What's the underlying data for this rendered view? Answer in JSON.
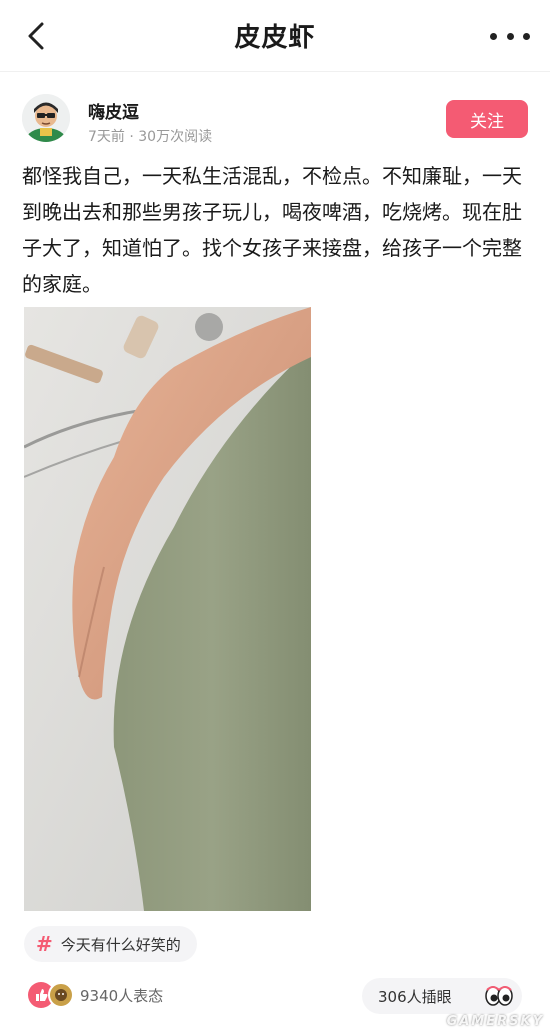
{
  "navbar": {
    "title": "皮皮虾",
    "back_icon": "chevron-left-icon",
    "more_icon": "more-dots-icon"
  },
  "author": {
    "name": "嗨皮逗",
    "meta": "7天前 · 30万次阅读",
    "follow_label": "关注"
  },
  "post": {
    "text": "都怪我自己，一天私生活混乱，不检点。不知廉耻，一天到晚出去和那些男孩子玩儿，喝夜啤酒，吃烧烤。现在肚子大了，知道怕了。找个女孩子来接盘，给孩子一个完整的家庭。"
  },
  "topic": {
    "label": "今天有什么好笑的"
  },
  "bottom": {
    "reactions_label": "9340人表态",
    "poke_label": "306人插眼"
  },
  "watermark": "GAMERSKY",
  "colors": {
    "accent": "#f45b73",
    "tag_bg": "#f4f4f6"
  }
}
